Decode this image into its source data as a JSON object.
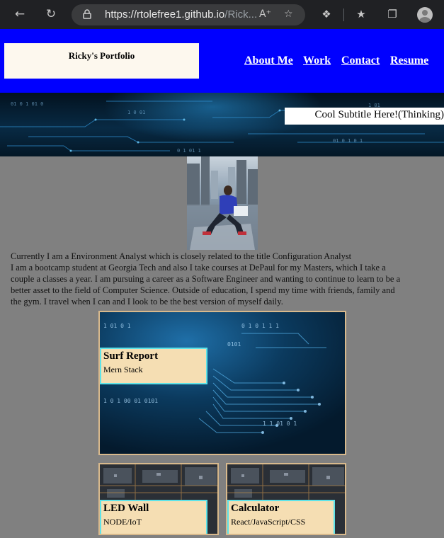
{
  "browser": {
    "url_host": "https://rtolefree1.github.io",
    "url_path": "/Rick..."
  },
  "header": {
    "brand": "Ricky's Portfolio",
    "nav": [
      "About Me",
      "Work",
      "Contact",
      "Resume"
    ],
    "background_color": "#0000ff"
  },
  "hero": {
    "subtitle": "Cool Subtitle Here!(Thinking)"
  },
  "bio": {
    "line1": "Currently I am a Environment Analyst which is closely related to the title Configuration Analyst",
    "paragraph": "I am a bootcamp student at Georgia Tech and also I take courses at DePaul for my Masters, which I take a couple a classes a year. I am pursuing a career as a Software Engineer and wanting to continue to learn to be a better asset to the field of Computer Science. Outside of education, I spend my time with friends, family and the gym. I travel when I can and I look to be the best version of myself daily."
  },
  "projects": [
    {
      "title": "Surf Report",
      "subtitle": "Mern Stack"
    },
    {
      "title": "LED Wall",
      "subtitle": "NODE/IoT"
    },
    {
      "title": "Calculator",
      "subtitle": "React/JavaScript/CSS"
    }
  ],
  "colors": {
    "page_background": "#808080",
    "label_background": "#f5deb3",
    "label_border": "#5ee3e8",
    "card_border": "#d8b98c"
  }
}
